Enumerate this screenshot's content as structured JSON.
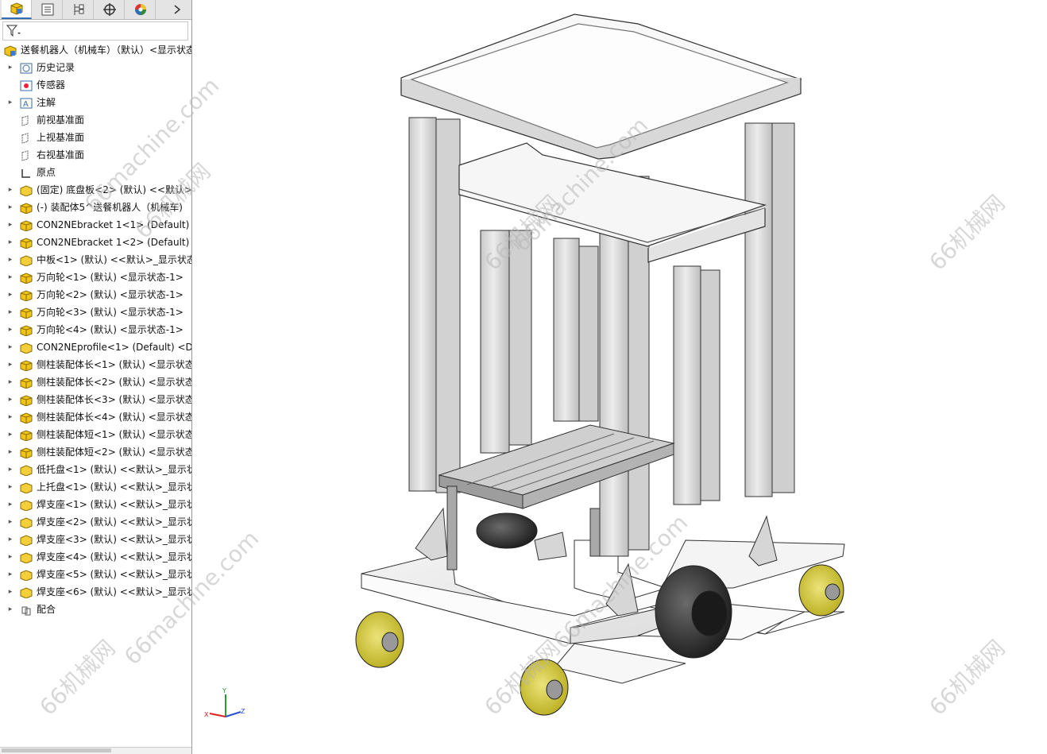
{
  "tabs": [
    {
      "icon": "feature-manager-icon"
    },
    {
      "icon": "property-manager-icon"
    },
    {
      "icon": "configuration-manager-icon"
    },
    {
      "icon": "dimxpert-icon"
    },
    {
      "icon": "display-manager-icon"
    }
  ],
  "tab_more_icon": "chevron-right-icon",
  "filter_icon": "filter-icon",
  "tree": [
    {
      "label": "送餐机器人（机械车）（默认）<显示状态",
      "icon": "assembly",
      "arrow": false,
      "level": 0
    },
    {
      "label": "历史记录",
      "icon": "history",
      "arrow": true,
      "level": 1
    },
    {
      "label": "传感器",
      "icon": "sensor",
      "arrow": false,
      "level": 1
    },
    {
      "label": "注解",
      "icon": "annotation",
      "arrow": true,
      "level": 1
    },
    {
      "label": "前视基准面",
      "icon": "plane",
      "arrow": false,
      "level": 1
    },
    {
      "label": "上视基准面",
      "icon": "plane",
      "arrow": false,
      "level": 1
    },
    {
      "label": "右视基准面",
      "icon": "plane",
      "arrow": false,
      "level": 1
    },
    {
      "label": "原点",
      "icon": "origin",
      "arrow": false,
      "level": 1
    },
    {
      "label": "(固定) 底盘板<2> (默认) <<默认>_",
      "icon": "part",
      "arrow": true,
      "level": 1
    },
    {
      "label": "(-) 装配体5^送餐机器人（机械车)",
      "icon": "subassembly",
      "arrow": true,
      "level": 1
    },
    {
      "label": "CON2NEbracket 1<1> (Default)",
      "icon": "subassembly",
      "arrow": true,
      "level": 1
    },
    {
      "label": "CON2NEbracket 1<2> (Default)",
      "icon": "subassembly",
      "arrow": true,
      "level": 1
    },
    {
      "label": "中板<1> (默认) <<默认>_显示状态",
      "icon": "part",
      "arrow": true,
      "level": 1
    },
    {
      "label": "万向轮<1> (默认) <显示状态-1>",
      "icon": "subassembly",
      "arrow": true,
      "level": 1
    },
    {
      "label": "万向轮<2> (默认) <显示状态-1>",
      "icon": "subassembly",
      "arrow": true,
      "level": 1
    },
    {
      "label": "万向轮<3> (默认) <显示状态-1>",
      "icon": "subassembly",
      "arrow": true,
      "level": 1
    },
    {
      "label": "万向轮<4> (默认) <显示状态-1>",
      "icon": "subassembly",
      "arrow": true,
      "level": 1
    },
    {
      "label": "CON2NEprofile<1> (Default) <D",
      "icon": "part",
      "arrow": true,
      "level": 1
    },
    {
      "label": "侧柱装配体长<1> (默认) <显示状态",
      "icon": "subassembly",
      "arrow": true,
      "level": 1
    },
    {
      "label": "侧柱装配体长<2> (默认) <显示状态",
      "icon": "subassembly",
      "arrow": true,
      "level": 1
    },
    {
      "label": "侧柱装配体长<3> (默认) <显示状态",
      "icon": "subassembly",
      "arrow": true,
      "level": 1
    },
    {
      "label": "侧柱装配体长<4> (默认) <显示状态",
      "icon": "subassembly",
      "arrow": true,
      "level": 1
    },
    {
      "label": "侧柱装配体短<1> (默认) <显示状态",
      "icon": "subassembly",
      "arrow": true,
      "level": 1
    },
    {
      "label": "侧柱装配体短<2> (默认) <显示状态",
      "icon": "subassembly",
      "arrow": true,
      "level": 1
    },
    {
      "label": "低托盘<1> (默认) <<默认>_显示状",
      "icon": "part",
      "arrow": true,
      "level": 1
    },
    {
      "label": "上托盘<1> (默认) <<默认>_显示状",
      "icon": "part",
      "arrow": true,
      "level": 1
    },
    {
      "label": "焊支座<1> (默认) <<默认>_显示状",
      "icon": "part",
      "arrow": true,
      "level": 1
    },
    {
      "label": "焊支座<2> (默认) <<默认>_显示状",
      "icon": "part",
      "arrow": true,
      "level": 1
    },
    {
      "label": "焊支座<3> (默认) <<默认>_显示状",
      "icon": "part",
      "arrow": true,
      "level": 1
    },
    {
      "label": "焊支座<4> (默认) <<默认>_显示状",
      "icon": "part",
      "arrow": true,
      "level": 1
    },
    {
      "label": "焊支座<5> (默认) <<默认>_显示状",
      "icon": "part",
      "arrow": true,
      "level": 1
    },
    {
      "label": "焊支座<6> (默认) <<默认>_显示状",
      "icon": "part",
      "arrow": true,
      "level": 1
    },
    {
      "label": "配合",
      "icon": "mates",
      "arrow": true,
      "level": 1
    }
  ],
  "watermark_texts": [
    "66machine.com",
    "66机械网"
  ],
  "triad_labels": {
    "x": "X",
    "y": "Y",
    "z": "Z"
  },
  "colors": {
    "wheel": "#d8cf3a",
    "frame": "#d4d4d4",
    "part_icon": "#f0c419",
    "tab_accent": "#2f6fb7"
  }
}
